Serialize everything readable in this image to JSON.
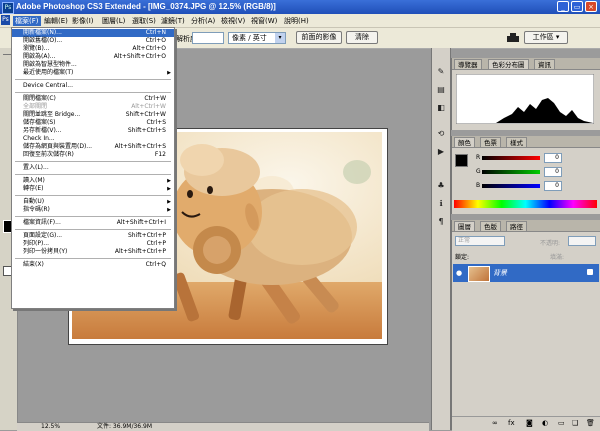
{
  "title_bar": {
    "title": "Adobe Photoshop CS3 Extended - [IMG_0374.JPG @ 12.5% (RGB/8)]",
    "app_icon": "Ps"
  },
  "window_controls": {
    "minimize": "_",
    "restore": "▭",
    "close": "×"
  },
  "menu_bar": {
    "items": [
      "檔案(F)",
      "編輯(E)",
      "影像(I)",
      "圖層(L)",
      "選取(S)",
      "濾鏡(T)",
      "分析(A)",
      "檢視(V)",
      "視窗(W)",
      "說明(H)"
    ]
  },
  "options_bar": {
    "resolution_label": "解析度:",
    "resolution_value": "",
    "unit": "像素 / 英寸",
    "front_image_button": "前面的影像",
    "clear_button": "清除",
    "workspace_label": "工作區 ▾"
  },
  "file_menu": {
    "items": [
      {
        "label": "開新檔案(N)...",
        "shortcut": "Ctrl+N",
        "highlighted": true
      },
      {
        "label": "開啟舊檔(O)...",
        "shortcut": "Ctrl+O"
      },
      {
        "label": "瀏覽(B)...",
        "shortcut": "Alt+Ctrl+O"
      },
      {
        "label": "開啟為(A)...",
        "shortcut": "Alt+Shift+Ctrl+O"
      },
      {
        "label": "開啟為智慧型物件..."
      },
      {
        "label": "最近使用的檔案(T)",
        "submenu": true
      },
      {
        "separator": true
      },
      {
        "label": "Device Central..."
      },
      {
        "separator": true
      },
      {
        "label": "關閉檔案(C)",
        "shortcut": "Ctrl+W"
      },
      {
        "label": "全部關閉",
        "shortcut": "Alt+Ctrl+W",
        "disabled": true
      },
      {
        "label": "關閉並跳至 Bridge...",
        "shortcut": "Shift+Ctrl+W"
      },
      {
        "label": "儲存檔案(S)",
        "shortcut": "Ctrl+S"
      },
      {
        "label": "另存新檔(V)...",
        "shortcut": "Shift+Ctrl+S"
      },
      {
        "label": "Check In..."
      },
      {
        "label": "儲存為網頁與裝置用(D)...",
        "shortcut": "Alt+Shift+Ctrl+S"
      },
      {
        "label": "回復至前次儲存(R)",
        "shortcut": "F12"
      },
      {
        "separator": true
      },
      {
        "label": "置入(L)..."
      },
      {
        "separator": true
      },
      {
        "label": "讀入(M)",
        "submenu": true
      },
      {
        "label": "轉存(E)",
        "submenu": true
      },
      {
        "separator": true
      },
      {
        "label": "自動(U)",
        "submenu": true
      },
      {
        "label": "指令碼(R)",
        "submenu": true
      },
      {
        "separator": true
      },
      {
        "label": "檔案資訊(F)...",
        "shortcut": "Alt+Shift+Ctrl+I"
      },
      {
        "separator": true
      },
      {
        "label": "頁面設定(G)...",
        "shortcut": "Shift+Ctrl+P"
      },
      {
        "label": "列印(P)...",
        "shortcut": "Ctrl+P"
      },
      {
        "label": "列印一份拷貝(Y)",
        "shortcut": "Alt+Shift+Ctrl+P"
      },
      {
        "separator": true
      },
      {
        "label": "結束(X)",
        "shortcut": "Ctrl+Q"
      }
    ]
  },
  "histogram_panel": {
    "tabs": [
      "導覽器",
      "色彩分布圖",
      "資訊"
    ]
  },
  "color_panel": {
    "tabs": [
      "顏色",
      "色票",
      "樣式"
    ],
    "channels": [
      {
        "label": "R",
        "value": "0",
        "color": "#d00000"
      },
      {
        "label": "G",
        "value": "0",
        "color": "#00a000"
      },
      {
        "label": "B",
        "value": "0",
        "color": "#0000d0"
      }
    ]
  },
  "layers_panel": {
    "tabs": [
      "圖層",
      "色版",
      "路徑"
    ],
    "blend_mode": "正常",
    "opacity_label": "不透明:",
    "lock_label": "鎖定:",
    "fill_label": "填滿:",
    "layer_name": "背景"
  },
  "status_bar": {
    "zoom": "12.5%",
    "doc_info": "文件: 36.9M/36.9M"
  },
  "colors": {
    "title_blue": "#2458c9",
    "menu_highlight": "#316ac5",
    "layer_selected": "#316ac5"
  }
}
